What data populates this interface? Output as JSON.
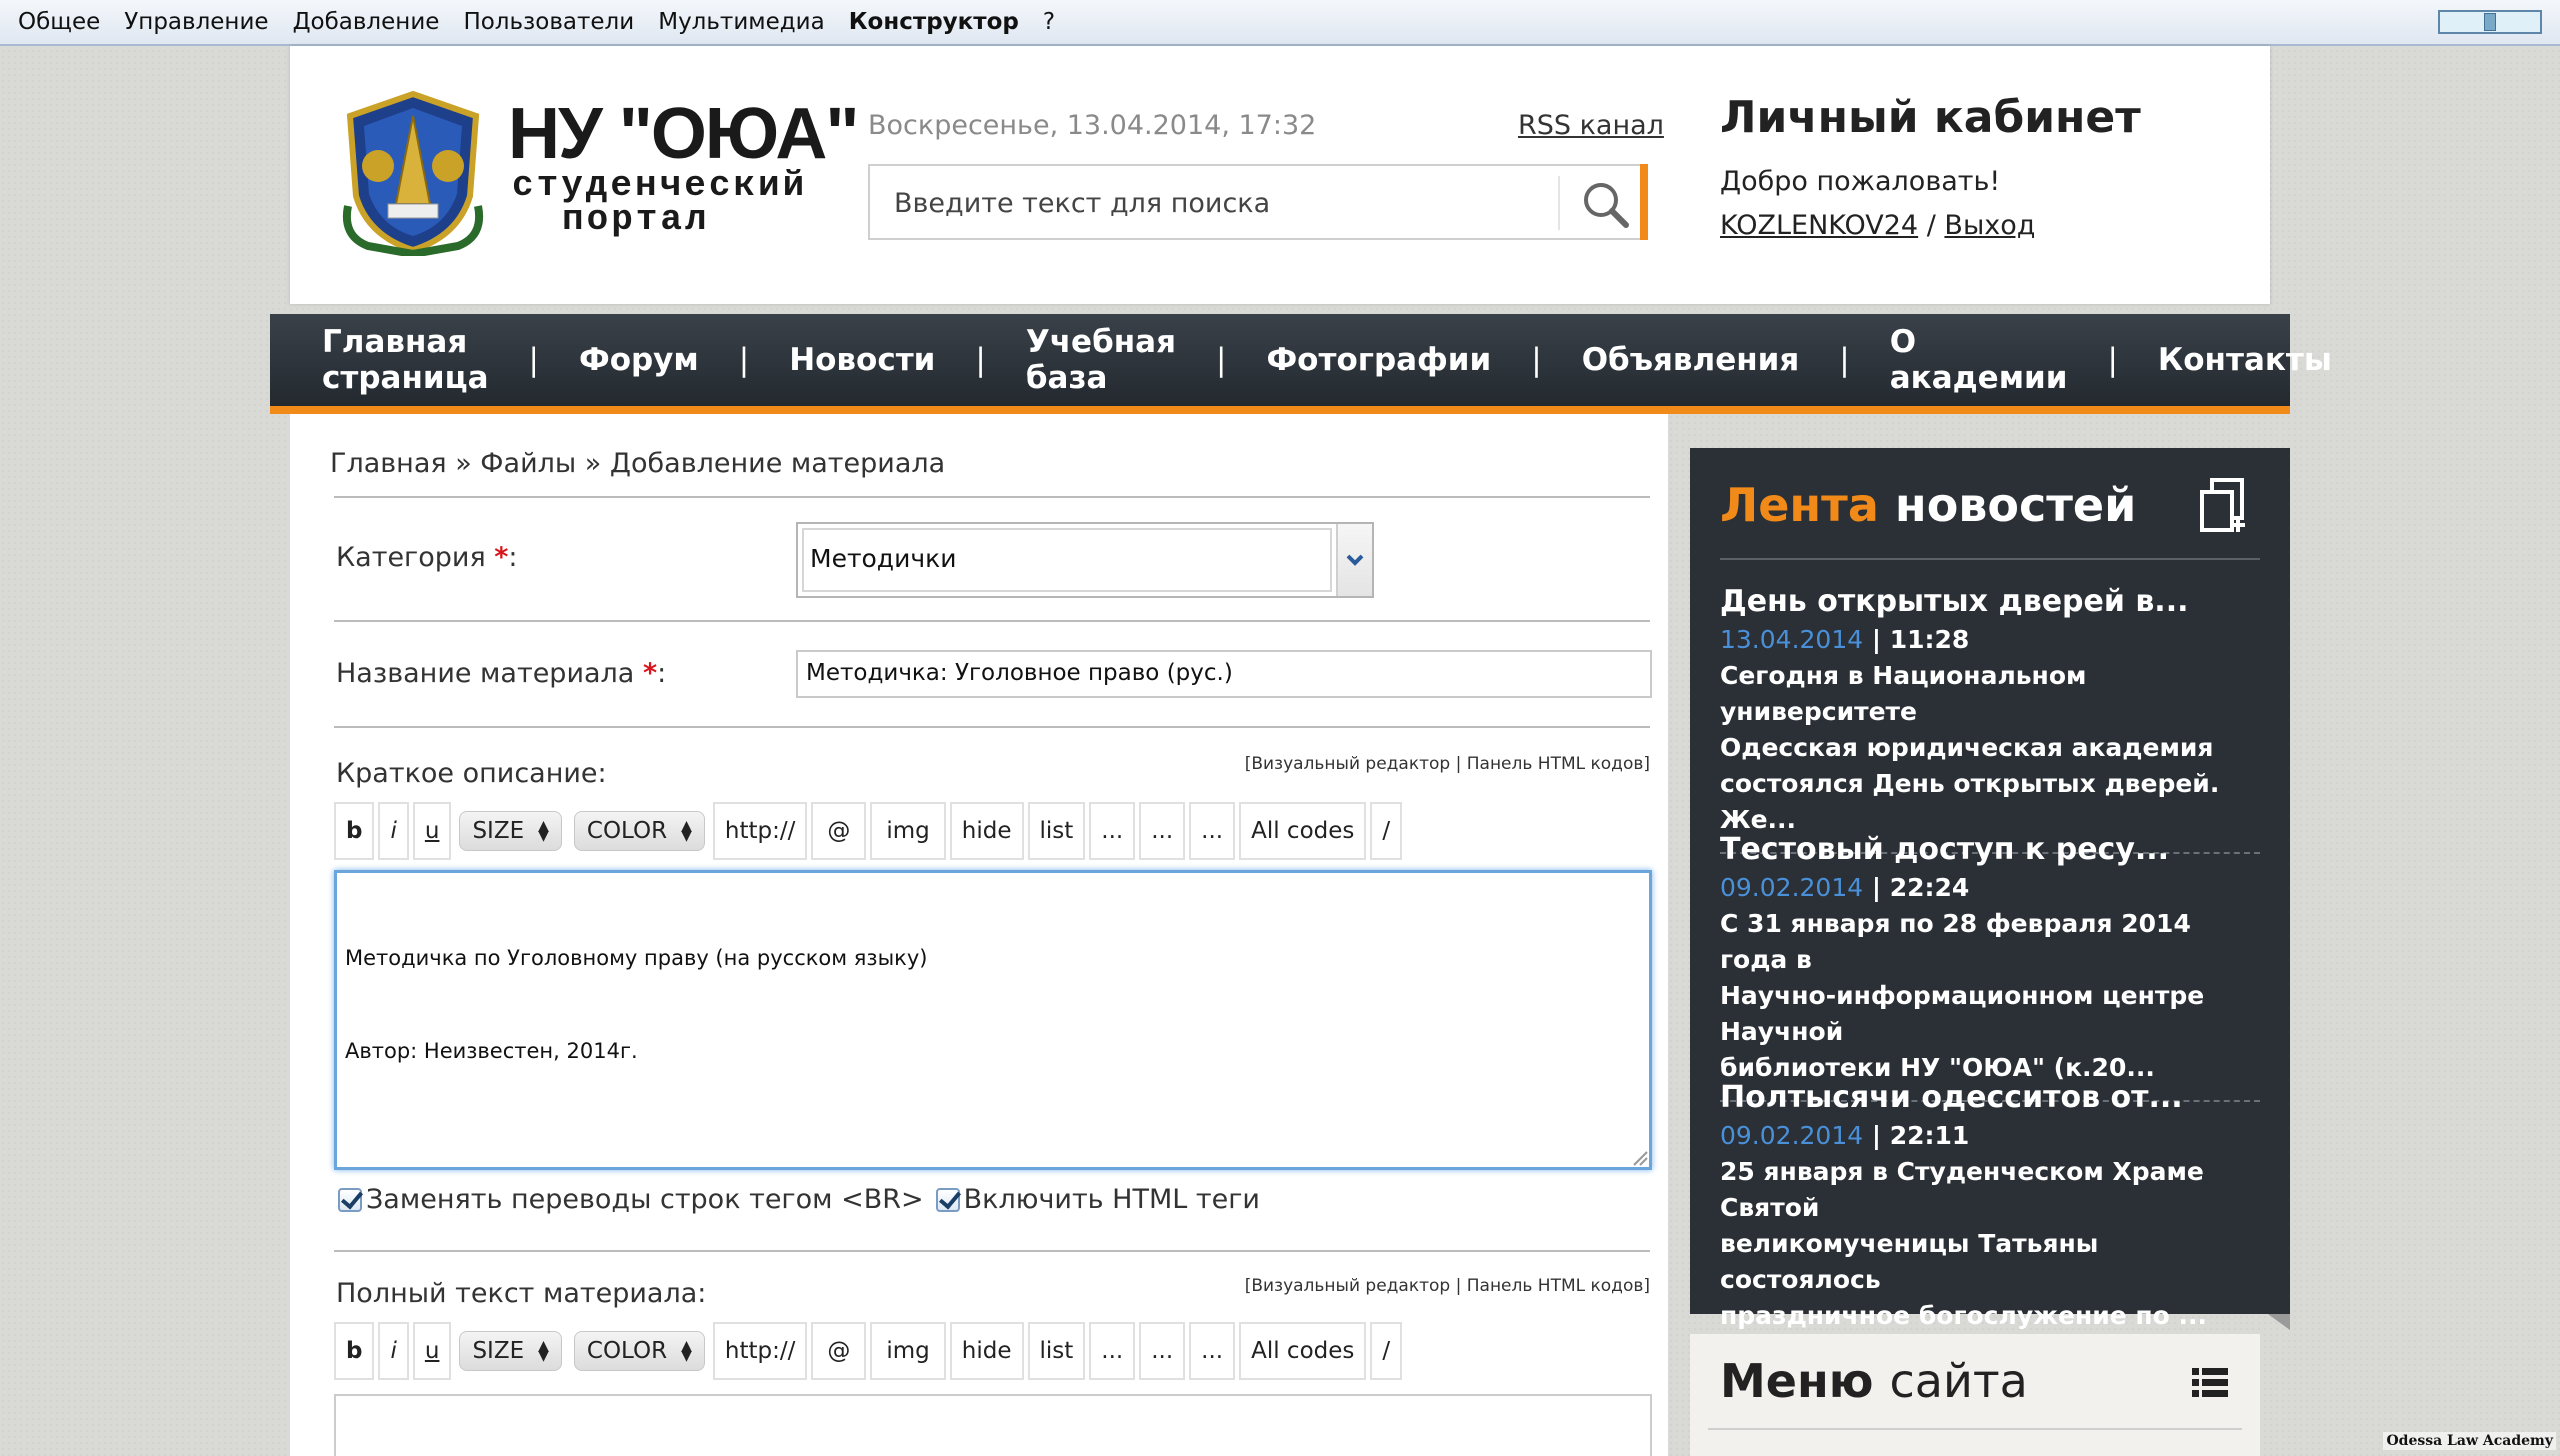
{
  "admin_bar": {
    "items": [
      "Общее",
      "Управление",
      "Добавление",
      "Пользователи",
      "Мультимедиа",
      "Конструктор",
      "?"
    ],
    "active": "Конструктор"
  },
  "header": {
    "logo_title": "НУ \"ОЮА\"",
    "logo_sub1": "студенческий",
    "logo_sub2": "портал",
    "date": "Воскресенье, 13.04.2014, 17:32",
    "rss_label": "RSS канал",
    "search_placeholder": "Введите текст для поиска",
    "cabinet_title": "Личный кабинет",
    "welcome": "Добро пожаловать!",
    "username": "KOZLENKOV24",
    "user_sep": "/",
    "logout": "Выход"
  },
  "nav": {
    "items": [
      "Главная страница",
      "Форум",
      "Новости",
      "Учебная база",
      "Фотографии",
      "Объявления",
      "О академии",
      "Контакты"
    ],
    "separator": "|"
  },
  "form": {
    "breadcrumb": "Главная » Файлы » Добавление материала",
    "category_label": "Категория",
    "required_mark": "*",
    "colon": ":",
    "category_value": "Методички",
    "title_label": "Название материала",
    "title_value": "Методичка: Уголовное право (рус.)",
    "short_desc_label": "Краткое описание:",
    "editor_links": "[Визуальный редактор | Панель HTML кодов]",
    "toolbar": {
      "bold": "b",
      "italic": "i",
      "underline": "u",
      "size": "SIZE",
      "color": "COLOR",
      "url": "http://",
      "email": "@",
      "img": "img",
      "hide": "hide",
      "list": "list",
      "dots": "...",
      "all_codes": "All codes",
      "close_tag": "/"
    },
    "short_desc_lines": [
      "Методичка по Уголовному праву (на русском языку)",
      "Автор: Неизвестен, 2014г."
    ],
    "checkbox_br": "Заменять переводы строк тегом <BR>",
    "checkbox_html": "Включить HTML теги",
    "full_text_label": "Полный текст материала:"
  },
  "news": {
    "title_accent": "Лента",
    "title_rest": "новостей",
    "items": [
      {
        "title": "День открытых дверей в...",
        "date": "13.04.2014",
        "time": "11:28",
        "text": [
          "Сегодня в Национальном университете",
          "Одесская юридическая академия",
          "состоялся День открытых дверей. Же..."
        ]
      },
      {
        "title": "Тестовый доступ к ресу...",
        "date": "09.02.2014",
        "time": "22:24",
        "text": [
          "С 31 января по 28 февраля 2014 года в",
          "Научно-информационном центре Научной",
          "библиотеки НУ \"ОЮА\" (к.20..."
        ]
      },
      {
        "title": "Полтысячи одесситов от...",
        "date": "09.02.2014",
        "time": "22:11",
        "text": [
          "25 января в Студенческом Храме Святой",
          "великомученицы Татьяны состоялось",
          "праздничное богослужение по ..."
        ]
      }
    ],
    "date_sep": "|"
  },
  "menu": {
    "title_bold": "Меню",
    "title_rest": "сайта"
  },
  "watermark": "Odessa Law Academy",
  "colors": {
    "accent": "#f28a1a",
    "nav_bg": "#2b3036",
    "date_blue": "#4a90d9",
    "required": "#d9141b"
  },
  "icons": [
    "search-icon",
    "news-copy-icon",
    "menu-list-icon",
    "chevron-down-icon",
    "emblem-logo"
  ]
}
